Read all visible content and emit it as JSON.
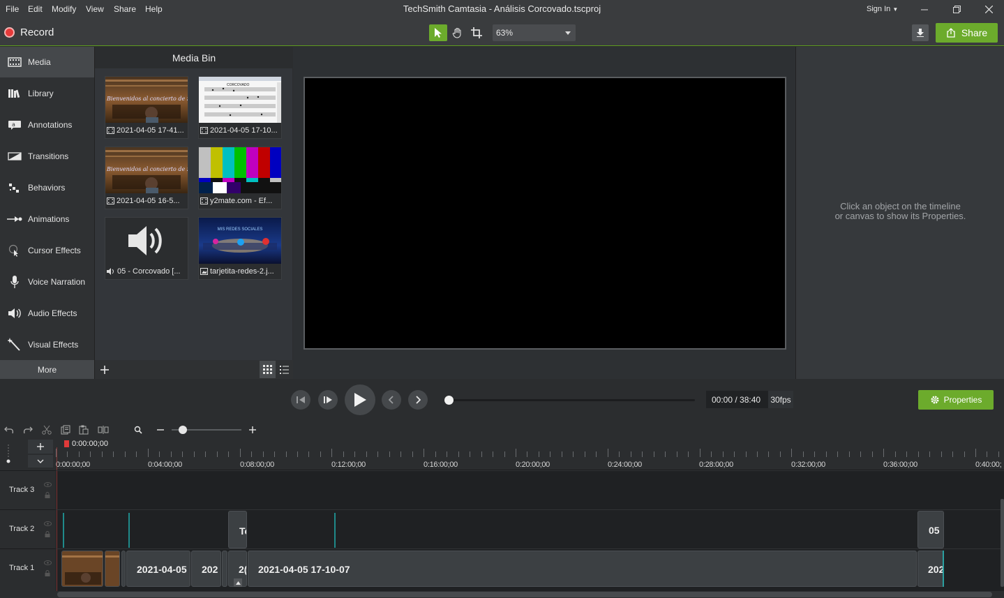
{
  "menu": {
    "items": [
      "File",
      "Edit",
      "Modify",
      "View",
      "Share",
      "Help"
    ],
    "title": "TechSmith Camtasia - Análisis Corcovado.tscproj",
    "sign_in": "Sign In"
  },
  "toolbar": {
    "record_label": "Record",
    "zoom_value": "63%",
    "share_label": "Share"
  },
  "sidebar": {
    "items": [
      {
        "label": "Media",
        "icon": "media-icon"
      },
      {
        "label": "Library",
        "icon": "library-icon"
      },
      {
        "label": "Annotations",
        "icon": "annotations-icon"
      },
      {
        "label": "Transitions",
        "icon": "transitions-icon"
      },
      {
        "label": "Behaviors",
        "icon": "behaviors-icon"
      },
      {
        "label": "Animations",
        "icon": "animations-icon"
      },
      {
        "label": "Cursor Effects",
        "icon": "cursor-effects-icon"
      },
      {
        "label": "Voice Narration",
        "icon": "microphone-icon"
      },
      {
        "label": "Audio Effects",
        "icon": "audio-effects-icon"
      },
      {
        "label": "Visual Effects",
        "icon": "visual-effects-icon"
      }
    ],
    "more_label": "More"
  },
  "media_bin": {
    "title": "Media Bin",
    "items": [
      {
        "caption": "2021-04-05 17-41...",
        "type": "video",
        "thumb_text": "Bienvenidos al concierto de Schubert"
      },
      {
        "caption": "2021-04-05 17-10...",
        "type": "video",
        "thumb_text": "CORCOVADO"
      },
      {
        "caption": "2021-04-05 16-5...",
        "type": "video",
        "thumb_text": "Bienvenidos al concierto de Schubert"
      },
      {
        "caption": "y2mate.com - Ef...",
        "type": "video",
        "thumb_text": ""
      },
      {
        "caption": "05 - Corcovado [...",
        "type": "audio",
        "thumb_text": ""
      },
      {
        "caption": "tarjetita-redes-2.j...",
        "type": "image",
        "thumb_text": "MIS REDES SOCIALES"
      }
    ]
  },
  "properties": {
    "hint_line1": "Click an object on the timeline",
    "hint_line2": "or canvas to show its Properties.",
    "button_label": "Properties"
  },
  "playback": {
    "time": "00:00 / 38:40",
    "fps": "30fps"
  },
  "timeline": {
    "playhead_time": "0:00:00;00",
    "ticks": [
      "0:00:00;00",
      "0:04:00;00",
      "0:08:00;00",
      "0:12:00;00",
      "0:16:00;00",
      "0:20:00;00",
      "0:24:00;00",
      "0:28:00;00",
      "0:32:00;00",
      "0:36:00;00",
      "0:40:00;"
    ],
    "tracks": [
      "Track 3",
      "Track 2",
      "Track 1"
    ],
    "clips": {
      "track2_a": "Te",
      "track2_b": "05",
      "track1_a": "2021-04-05",
      "track1_b": "202",
      "track1_c": "2(",
      "track1_d": "2021-04-05 17-10-07",
      "track1_e": "202"
    }
  },
  "colors": {
    "accent_green": "#6cab2c",
    "record_red": "#e63a3a",
    "marker_teal": "#1f8a8a"
  }
}
